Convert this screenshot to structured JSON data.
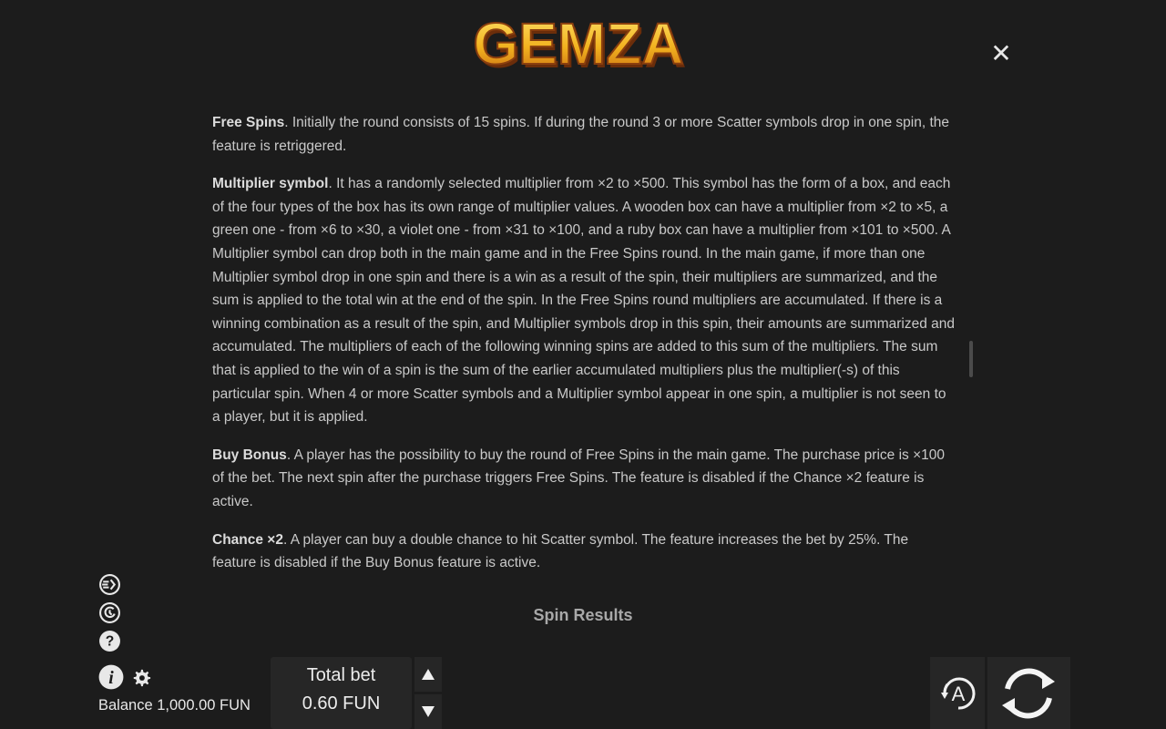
{
  "header": {
    "logo_text": "GEMZA",
    "close_glyph": "✕"
  },
  "rules": {
    "free_spins": {
      "title": "Free Spins",
      "text": ". Initially the round consists of 15 spins. If during the round 3 or more Scatter symbols drop in one spin, the feature is retriggered."
    },
    "multiplier": {
      "title": "Multiplier symbol",
      "text": ". It has a randomly selected multiplier from ×2 to ×500. This symbol has the form of a box, and each of the four types of the box has its own range of multiplier values. A wooden box can have a multiplier from ×2 to ×5, a green one - from ×6 to ×30, a violet one - from ×31 to ×100, and a ruby box can have a multiplier from ×101 to ×500. A Multiplier symbol can drop both in the main game and in the Free Spins round. In the main game, if more than one Multiplier symbol drop in one spin and there is a win as a result of the spin, their multipliers are summarized, and the sum is applied to the total win at the end of the spin. In the Free Spins round multipliers are accumulated. If there is a winning combination as a result of the spin, and Multiplier symbols drop in this spin, their amounts are summarized and accumulated. The multipliers of each of the following winning spins are added to this sum of the multipliers. The sum that is applied to the win of a spin is the sum of the earlier accumulated multipliers plus the multiplier(-s) of this particular spin. When 4 or more Scatter symbols and a Multiplier symbol appear in one spin, a multiplier is not seen to a player, but it is applied."
    },
    "buy_bonus": {
      "title": "Buy Bonus",
      "text": ". A player has the possibility to buy the round of Free Spins in the main game. The purchase price is ×100 of the bet. The next spin after the purchase triggers Free Spins. The feature is disabled if the Chance ×2 feature is active."
    },
    "chance": {
      "title": "Chance ×2",
      "text": ". A player can buy a double chance to hit Scatter symbol. The feature increases the bet by 25%. The feature is disabled if the Buy Bonus feature is active."
    },
    "next_section": "Spin Results"
  },
  "footer": {
    "balance": "Balance 1,000.00 FUN",
    "bet_label": "Total bet",
    "bet_value": "0.60 FUN",
    "auto_label": "A",
    "icons": [
      "turbo-icon",
      "history-icon",
      "help-icon",
      "info-icon",
      "gear-icon",
      "bet-up-icon",
      "bet-down-icon",
      "autoplay-icon",
      "spin-icon"
    ]
  },
  "colors": {
    "background": "#1c1c1c",
    "text": "#c9c9c9",
    "logo_fill": "#f2b21f",
    "logo_shadow": "#8a3f0e"
  }
}
